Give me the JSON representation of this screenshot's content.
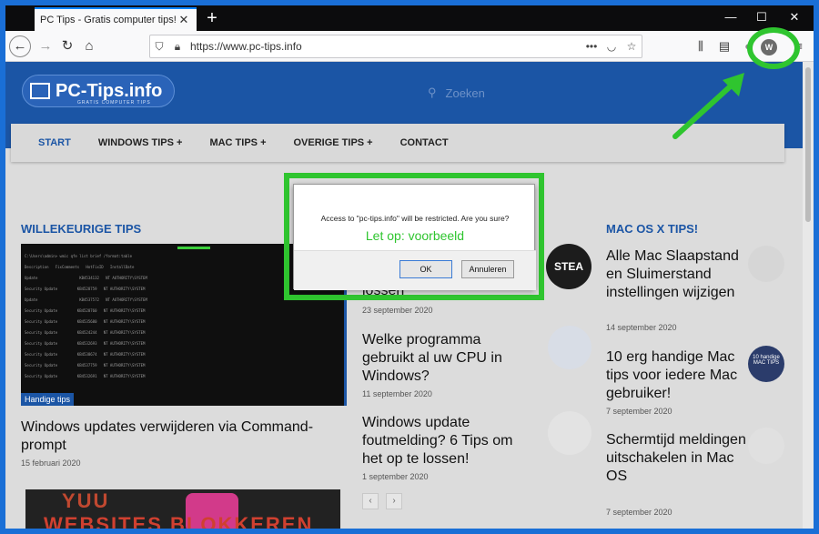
{
  "browser": {
    "tab": {
      "title": "PC Tips - Gratis computer tips! - PC",
      "close": "✕"
    },
    "new_tab": "+",
    "window_controls": {
      "minimize": "—",
      "maximize": "☐",
      "close": "✕"
    },
    "url": "https://www.pc-tips.info",
    "profile_initial": "W",
    "accent": "#0a84ff"
  },
  "site": {
    "logo": "PC-Tips.info",
    "logo_sub": "GRATIS COMPUTER TIPS",
    "search_placeholder": "Zoeken",
    "menu": [
      {
        "label": "START"
      },
      {
        "label": "WINDOWS TIPS +"
      },
      {
        "label": "MAC TIPS +"
      },
      {
        "label": "OVERIGE TIPS +"
      },
      {
        "label": "CONTACT"
      }
    ],
    "brand_color": "#1b55a5"
  },
  "left": {
    "heading": "WILLEKEURIGE TIPS",
    "hero_tag": "Handige tips",
    "hero_title": "Windows updates verwijderen via Command-prompt",
    "hero_date": "15 februari 2020",
    "bottom_text_1": "YUU",
    "bottom_text_2": "WEBSITES BLOKKEREN"
  },
  "middle": {
    "partial_title": "lossen",
    "partial_date": "23 september 2020",
    "steam_label": "STEA",
    "items": [
      {
        "title": "Welke programma gebruikt al uw CPU in Windows?",
        "date": "11 september 2020"
      },
      {
        "title": "Windows update foutmelding? 6 Tips om het op te lossen!",
        "date": "1 september 2020"
      }
    ],
    "pager_prev": "‹",
    "pager_next": "›"
  },
  "right": {
    "heading": "MAC OS X TIPS!",
    "items": [
      {
        "title": "Alle Mac Slaapstand en Sluimerstand instellingen wijzigen",
        "date": "14 september 2020"
      },
      {
        "title": "10 erg handige Mac tips voor iedere Mac gebruiker!",
        "date": "7 september 2020"
      },
      {
        "title": "Schermtijd meldingen uitschakelen in Mac OS",
        "date": "7 september 2020"
      }
    ],
    "thumb_text": "10 handige MAC TIPS"
  },
  "dialog": {
    "message": "Access to \"pc-tips.info\" will be restricted. Are you sure?",
    "note": "Let op: voorbeeld",
    "ok": "OK",
    "cancel": "Annuleren",
    "highlight_color": "#2fc52f"
  }
}
